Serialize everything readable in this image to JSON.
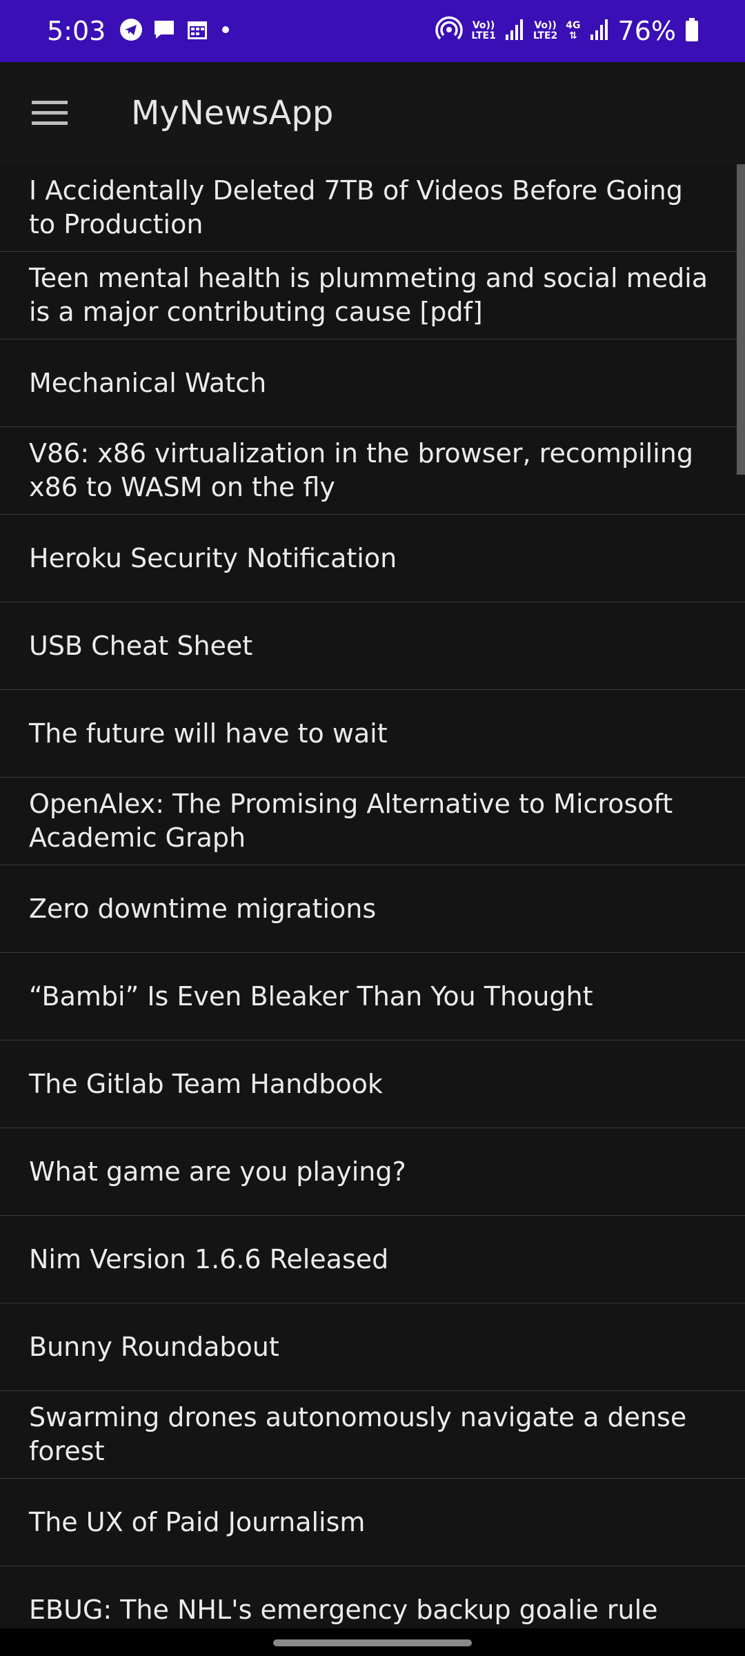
{
  "status_bar": {
    "time": "5:03",
    "battery": "76%",
    "sim1_top": "Vo))",
    "sim1_bottom": "LTE1",
    "sim2_top": "Vo))",
    "sim2_bottom": "LTE2",
    "network": "4G",
    "accent": "#3a0fb5"
  },
  "app_bar": {
    "title": "MyNewsApp"
  },
  "news": {
    "items": [
      "I Accidentally Deleted 7TB of Videos Before Going to Production",
      "Teen mental health is plummeting and social media is a major contributing cause [pdf]",
      "Mechanical Watch",
      "V86: x86 virtualization in the browser, recompiling x86 to WASM on the fly",
      "Heroku Security Notification",
      "USB Cheat Sheet",
      "The future will have to wait",
      "OpenAlex: The Promising Alternative to Microsoft Academic Graph",
      "Zero downtime migrations",
      "“Bambi” Is Even Bleaker Than You Thought",
      "The Gitlab Team Handbook",
      "What game are you playing?",
      "Nim Version 1.6.6 Released",
      "Bunny Roundabout",
      "Swarming drones autonomously navigate a dense forest",
      "The UX of Paid Journalism",
      "EBUG: The NHL's emergency backup goalie rule"
    ]
  }
}
